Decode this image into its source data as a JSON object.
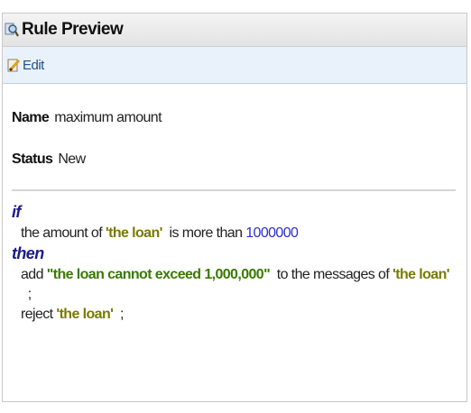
{
  "header": {
    "title": "Rule Preview",
    "icon": "magnifier-rule-icon"
  },
  "toolbar": {
    "edit_label": "Edit",
    "edit_icon": "pencil-edit-icon"
  },
  "fields": {
    "name_label": "Name",
    "name_value": "maximum amount",
    "status_label": "Status",
    "status_value": "New"
  },
  "rule": {
    "if_kw": "if",
    "cond_pre": "the amount of ",
    "cond_str": "'the loan'",
    "cond_mid": "  is more than ",
    "cond_num": "1000000",
    "then_kw": "then",
    "act1_pre": "add ",
    "act1_str": "\"the loan cannot exceed 1,000,000\"",
    "act1_mid": "  to the messages of ",
    "act1_str2": "'the loan'",
    "act1_end": "  ;",
    "act2_pre": "reject ",
    "act2_str": "'the loan'",
    "act2_end": "  ;"
  },
  "colors": {
    "keyword": "#1a1a8a",
    "string": "#7a7a00",
    "message_string": "#3a7a00",
    "number": "#2f2fd0",
    "toolbar_bg": "#e9f2fb"
  }
}
